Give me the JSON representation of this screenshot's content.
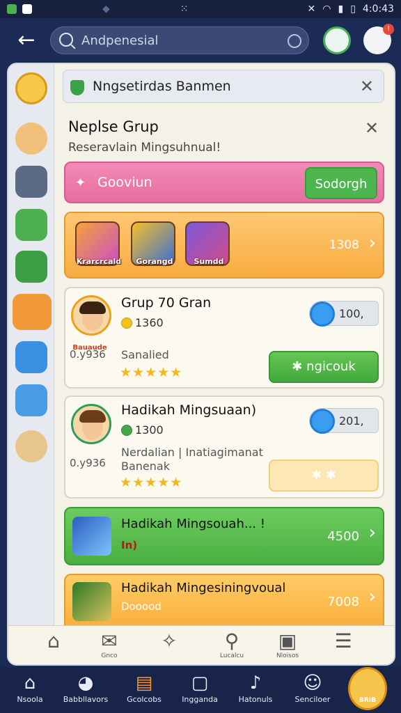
{
  "status_bar": {
    "time": "4:0:43"
  },
  "header": {
    "search_text": "Andpenesial"
  },
  "notification": {
    "text": "Nngsetirdas Banmen"
  },
  "panel": {
    "title": "Neplse Grup",
    "subtitle": "Reseravlain Mingsuhnual!",
    "search_row": {
      "placeholder": "Gooviun",
      "button": "Sodorgh"
    },
    "games": {
      "items": [
        {
          "label": "Krarcrcald"
        },
        {
          "label": "Gorangd"
        },
        {
          "label": "Sumdd"
        }
      ],
      "count": "1308"
    },
    "cards": [
      {
        "title": "Grup 70 Gran",
        "coins": "1360",
        "side_label": "0.y936",
        "detail_line1": "Sanalied",
        "detail_line2": "",
        "rating": "★★★★★",
        "pill_value": "100,",
        "button": "ngicouk",
        "button_icon": "✱",
        "avatar_badge": "Bauaude"
      },
      {
        "title": "Hadikah Mingsuaan)",
        "coins": "1300",
        "side_label": "0.y936",
        "detail_line1": "Nerdalian | Inatiagimanat",
        "detail_line2": "Banenak",
        "rating": "★★★★★",
        "pill_value": "201,",
        "button": "✱   ✱",
        "button_icon": "",
        "avatar_badge": ""
      }
    ],
    "green_banner": {
      "title": "Hadikah Mingsouah... !",
      "value": "4500",
      "sub": "In)"
    },
    "orange_banner": {
      "title": "Hadikah Mingesiningvoual",
      "value": "7008",
      "sub": "Dooood"
    },
    "tab_bar": [
      {
        "label": "",
        "icon": "home-icon"
      },
      {
        "label": "Gnco",
        "icon": "chat-icon"
      },
      {
        "label": "",
        "icon": "puzzle-icon"
      },
      {
        "label": "Lucalcu",
        "icon": "search-person-icon"
      },
      {
        "label": "Nloisos",
        "icon": "image-icon"
      },
      {
        "label": "",
        "icon": "list-icon"
      }
    ]
  },
  "bottom_nav": [
    {
      "label": "Nsoola",
      "icon": "house-icon"
    },
    {
      "label": "Babbllavors",
      "icon": "drop-icon"
    },
    {
      "label": "Gcolcobs",
      "icon": "chest-icon"
    },
    {
      "label": "Ingganda",
      "icon": "square-icon"
    },
    {
      "label": "Hatonuls",
      "icon": "bell-icon"
    },
    {
      "label": "Senciloer",
      "icon": "profile-icon"
    },
    {
      "label": "BRIB",
      "icon": "avatar-icon"
    }
  ],
  "colors": {
    "header_bg": "#1c2b56",
    "accent_green": "#4db54e",
    "accent_pink": "#e66e9f",
    "accent_orange": "#f7ab3f"
  }
}
